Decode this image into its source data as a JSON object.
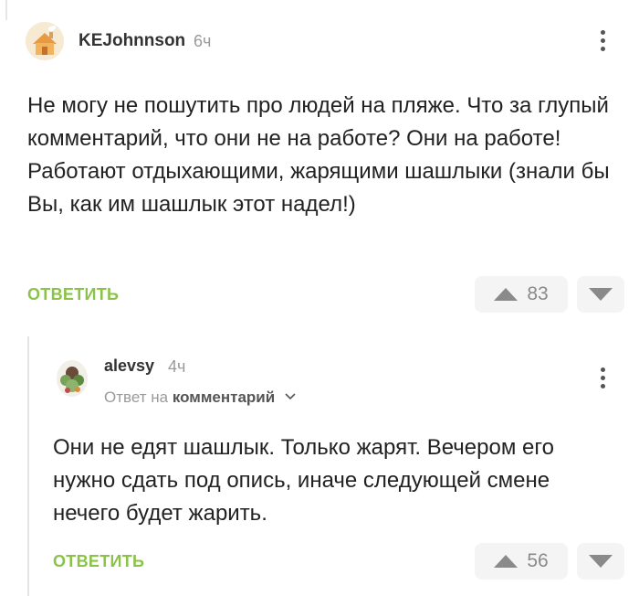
{
  "comment1": {
    "username": "KEJohnnson",
    "time": "6ч",
    "text": "Не могу не пошутить про людей на пляже. Что за глупый комментарий, что они не на работе? Они на работе! Работают отдыхающими, жарящими шашлыки (знали бы Вы, как им шашлык этот надел!)",
    "reply_label": "ОТВЕТИТЬ",
    "rating": "83",
    "accent": "#8bc34a"
  },
  "comment2": {
    "username": "alevsy",
    "time": "4ч",
    "reply_to_prefix": "Ответ на",
    "reply_to_target": "комментарий",
    "text": "Они не едят шашлык. Только жарят. Вечером его нужно сдать под опись, иначе следующей смене нечего будет жарить.",
    "reply_label": "ОТВЕТИТЬ",
    "rating": "56"
  },
  "icons": {
    "menu": "kebab-menu-icon",
    "upvote": "triangle-up-icon",
    "downvote": "triangle-down-icon",
    "expand": "chevron-down-icon"
  }
}
